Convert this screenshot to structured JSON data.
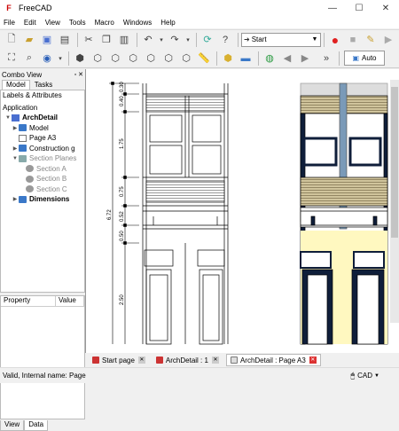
{
  "app": {
    "title": "FreeCAD"
  },
  "window_controls": {
    "minimize": "—",
    "maximize": "☐",
    "close": "✕"
  },
  "menu": [
    "File",
    "Edit",
    "View",
    "Tools",
    "Macro",
    "Windows",
    "Help"
  ],
  "toolbar": {
    "workbench": "Start",
    "view_mode": "Auto"
  },
  "combo": {
    "title": "Combo View",
    "tabs": [
      "Model",
      "Tasks"
    ],
    "bottom_tabs": [
      "View",
      "Data"
    ]
  },
  "tree": {
    "section_label": "Labels & Attributes",
    "application": "Application",
    "items": [
      {
        "label": "ArchDetail"
      },
      {
        "label": "Model"
      },
      {
        "label": "Page A3"
      },
      {
        "label": "Construction g"
      },
      {
        "label": "Section Planes"
      },
      {
        "label": "Section A"
      },
      {
        "label": "Section B"
      },
      {
        "label": "Section C"
      },
      {
        "label": "Dimensions"
      }
    ]
  },
  "properties": {
    "headers": [
      "Property",
      "Value"
    ]
  },
  "drawing": {
    "dimensions": [
      "6.72",
      "0.40",
      "0.30",
      "1.75",
      "0.75",
      "0.52",
      "0.50",
      "2.50"
    ]
  },
  "doc_tabs": [
    "Start page",
    "ArchDetail : 1",
    "ArchDetail : Page A3"
  ],
  "status": {
    "text": "Valid, Internal name: Page",
    "nav_style": "CAD"
  },
  "colors": {
    "accent": "#3a78c8",
    "close_red": "#d33",
    "wall_fill": "#fff8c0",
    "slat_fill": "#d0c49c"
  }
}
